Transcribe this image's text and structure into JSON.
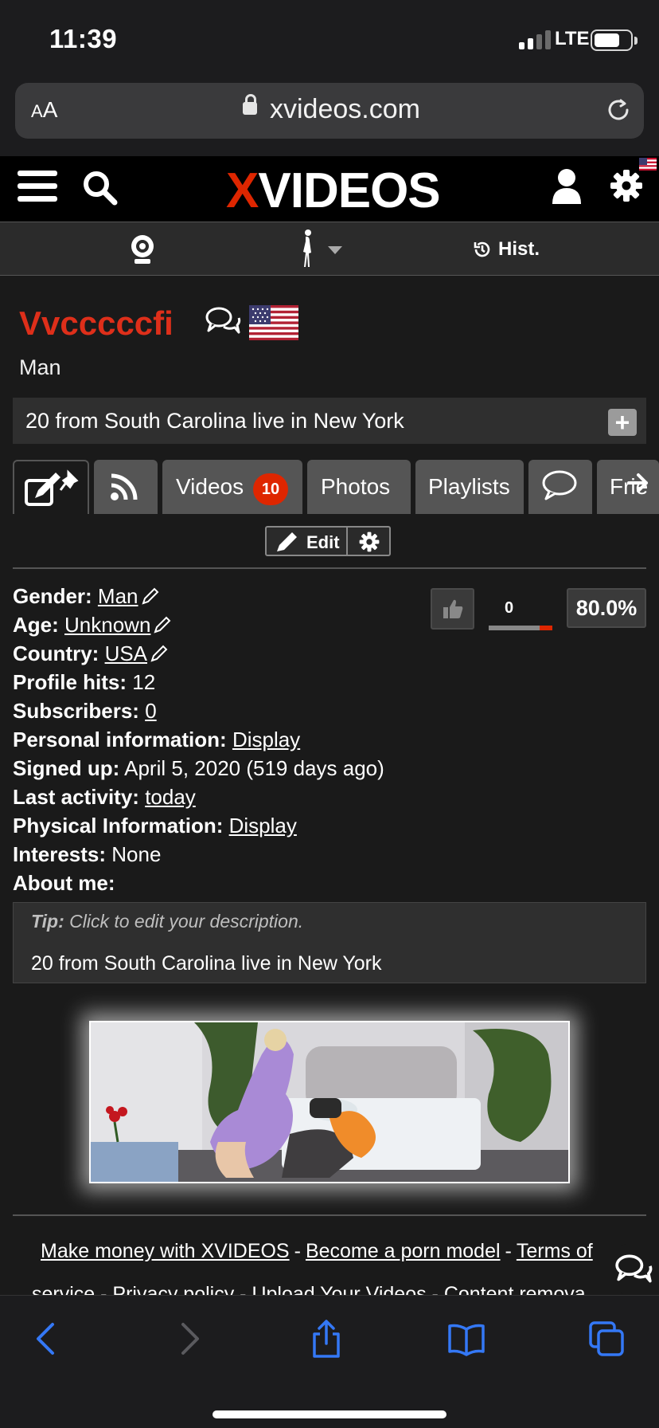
{
  "status_bar": {
    "time": "11:39",
    "network": "LTE"
  },
  "browser": {
    "text_size_button": {
      "small_a": "A",
      "large_a": "A"
    },
    "url": "xvideos.com"
  },
  "site_header": {
    "logo_x": "X",
    "logo_rest": "VIDEOS"
  },
  "sub_nav": {
    "history_label": "Hist."
  },
  "profile": {
    "name": "Vvcccccfi",
    "gender_line": "Man",
    "headline": "20 from South Carolina live in New York",
    "plus_label": "+"
  },
  "tabs": {
    "videos_label": "Videos",
    "videos_count": "10",
    "photos_label": "Photos",
    "playlists_label": "Playlists",
    "friends_label": "Frie"
  },
  "edit_toolbar": {
    "edit_label": "Edit"
  },
  "details": {
    "gender_label": "Gender:",
    "gender_value": "Man",
    "age_label": "Age:",
    "age_value": "Unknown",
    "country_label": "Country:",
    "country_value": "USA",
    "hits_label": "Profile hits:",
    "hits_value": "12",
    "subs_label": "Subscribers:",
    "subs_value": "0",
    "personal_label": "Personal information:",
    "personal_value": "Display",
    "signed_label": "Signed up:",
    "signed_value": "April 5, 2020 (519 days ago)",
    "activity_label": "Last activity:",
    "activity_value": "today",
    "physical_label": "Physical Information:",
    "physical_value": "Display",
    "interests_label": "Interests:",
    "interests_value": "None",
    "about_label": "About me:"
  },
  "vote": {
    "count": "0",
    "percent": "80.0%",
    "bad_fraction": 0.2
  },
  "about": {
    "tip_label": "Tip:",
    "tip_text": "Click to edit your description.",
    "text": "20 from South Carolina live in New York"
  },
  "footer": {
    "link1": "Make money with XVIDEOS",
    "link2": "Become a porn model",
    "link3_part": "Terms of",
    "line2_text": "service - Privacy policy - Upload Your Videos - Content remova",
    "separator": "-"
  },
  "colors": {
    "brand_red": "#de2600",
    "name_red": "#de2f1a",
    "safari_blue": "#3478f6"
  }
}
